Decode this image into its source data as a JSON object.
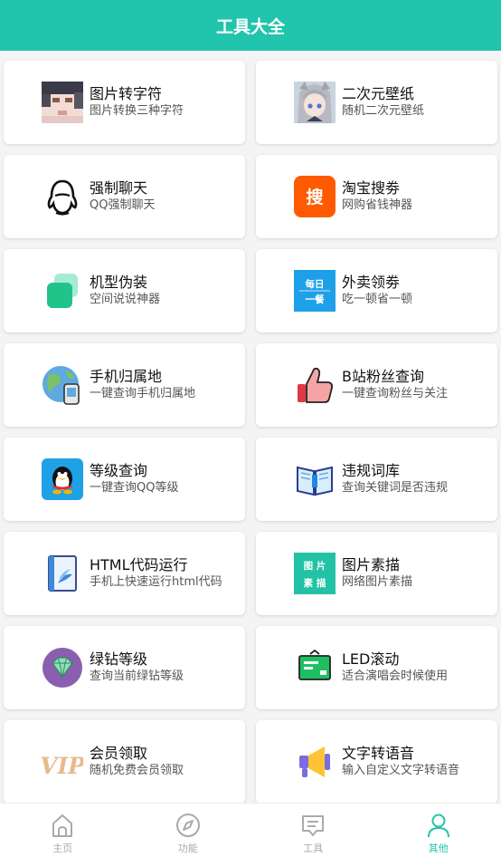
{
  "header": {
    "title": "工具大全"
  },
  "tools": [
    {
      "title": "图片转字符",
      "desc": "图片转换三种字符",
      "icon": "blurred-photo-icon"
    },
    {
      "title": "二次元壁纸",
      "desc": "随机二次元壁纸",
      "icon": "anime-girl-icon"
    },
    {
      "title": "强制聊天",
      "desc": "QQ强制聊天",
      "icon": "penguin-outline-icon"
    },
    {
      "title": "淘宝搜劵",
      "desc": "网购省钱神器",
      "icon": "taobao-search-icon",
      "icon_text": "搜"
    },
    {
      "title": "机型伪装",
      "desc": "空间说说神器",
      "icon": "device-layers-icon"
    },
    {
      "title": "外卖领劵",
      "desc": "吃一顿省一顿",
      "icon": "daily-meal-icon",
      "icon_text_1": "每日",
      "icon_text_2": "一餐"
    },
    {
      "title": "手机归属地",
      "desc": "一键查询手机归属地",
      "icon": "globe-phone-icon"
    },
    {
      "title": "B站粉丝查询",
      "desc": "一键查询粉丝与关注",
      "icon": "thumbs-up-icon"
    },
    {
      "title": "等级查询",
      "desc": "一键查询QQ等级",
      "icon": "qq-penguin-icon"
    },
    {
      "title": "违规词库",
      "desc": "查询关键词是否违规",
      "icon": "open-book-icon"
    },
    {
      "title": "HTML代码运行",
      "desc": "手机上快速运行html代码",
      "icon": "code-book-icon"
    },
    {
      "title": "图片素描",
      "desc": "网络图片素描",
      "icon": "picture-sketch-icon",
      "icon_text_1": "图 片",
      "icon_text_2": "素 描"
    },
    {
      "title": "绿钻等级",
      "desc": "查询当前绿钻等级",
      "icon": "green-diamond-icon"
    },
    {
      "title": "LED滚动",
      "desc": "适合演唱会时候使用",
      "icon": "led-board-icon"
    },
    {
      "title": "会员领取",
      "desc": "随机免费会员领取",
      "icon": "vip-icon",
      "icon_text": "VIP"
    },
    {
      "title": "文字转语音",
      "desc": "输入自定义文字转语音",
      "icon": "megaphone-icon"
    }
  ],
  "tabbar": [
    {
      "label": "主页",
      "icon": "home-icon",
      "active": false
    },
    {
      "label": "功能",
      "icon": "compass-icon",
      "active": false
    },
    {
      "label": "工具",
      "icon": "message-icon",
      "active": false
    },
    {
      "label": "其他",
      "icon": "person-icon",
      "active": true
    }
  ],
  "colors": {
    "accent": "#21c4ac",
    "tab_inactive": "#aaaaaa"
  }
}
